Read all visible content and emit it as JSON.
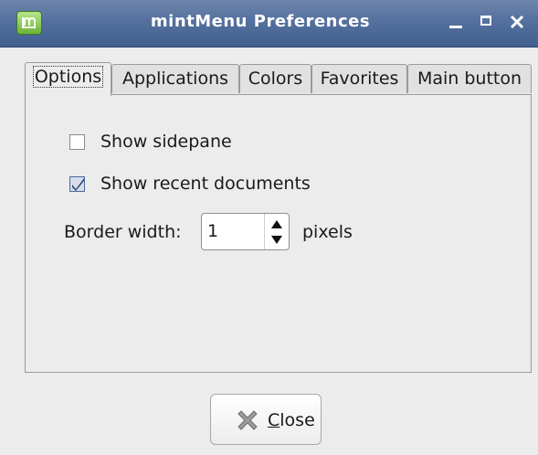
{
  "window": {
    "title": "mintMenu Preferences"
  },
  "tabs": [
    {
      "label": "Options",
      "active": true
    },
    {
      "label": "Applications",
      "active": false
    },
    {
      "label": "Colors",
      "active": false
    },
    {
      "label": "Favorites",
      "active": false
    },
    {
      "label": "Main button",
      "active": false
    }
  ],
  "options": {
    "show_sidepane": {
      "label": "Show sidepane",
      "checked": false
    },
    "show_recent_documents": {
      "label": "Show recent documents",
      "checked": true
    },
    "border_width": {
      "label": "Border width:",
      "value": "1",
      "unit": "pixels"
    }
  },
  "buttons": {
    "close": {
      "mnemonic": "C",
      "rest": "lose",
      "icon": "close-x-icon"
    }
  },
  "colors": {
    "titlebar": "#54709e",
    "title_text": "#ffffff",
    "window_bg": "#ececec",
    "checkmark": "#2b4a7a",
    "close_icon": "#8a8a8a"
  }
}
